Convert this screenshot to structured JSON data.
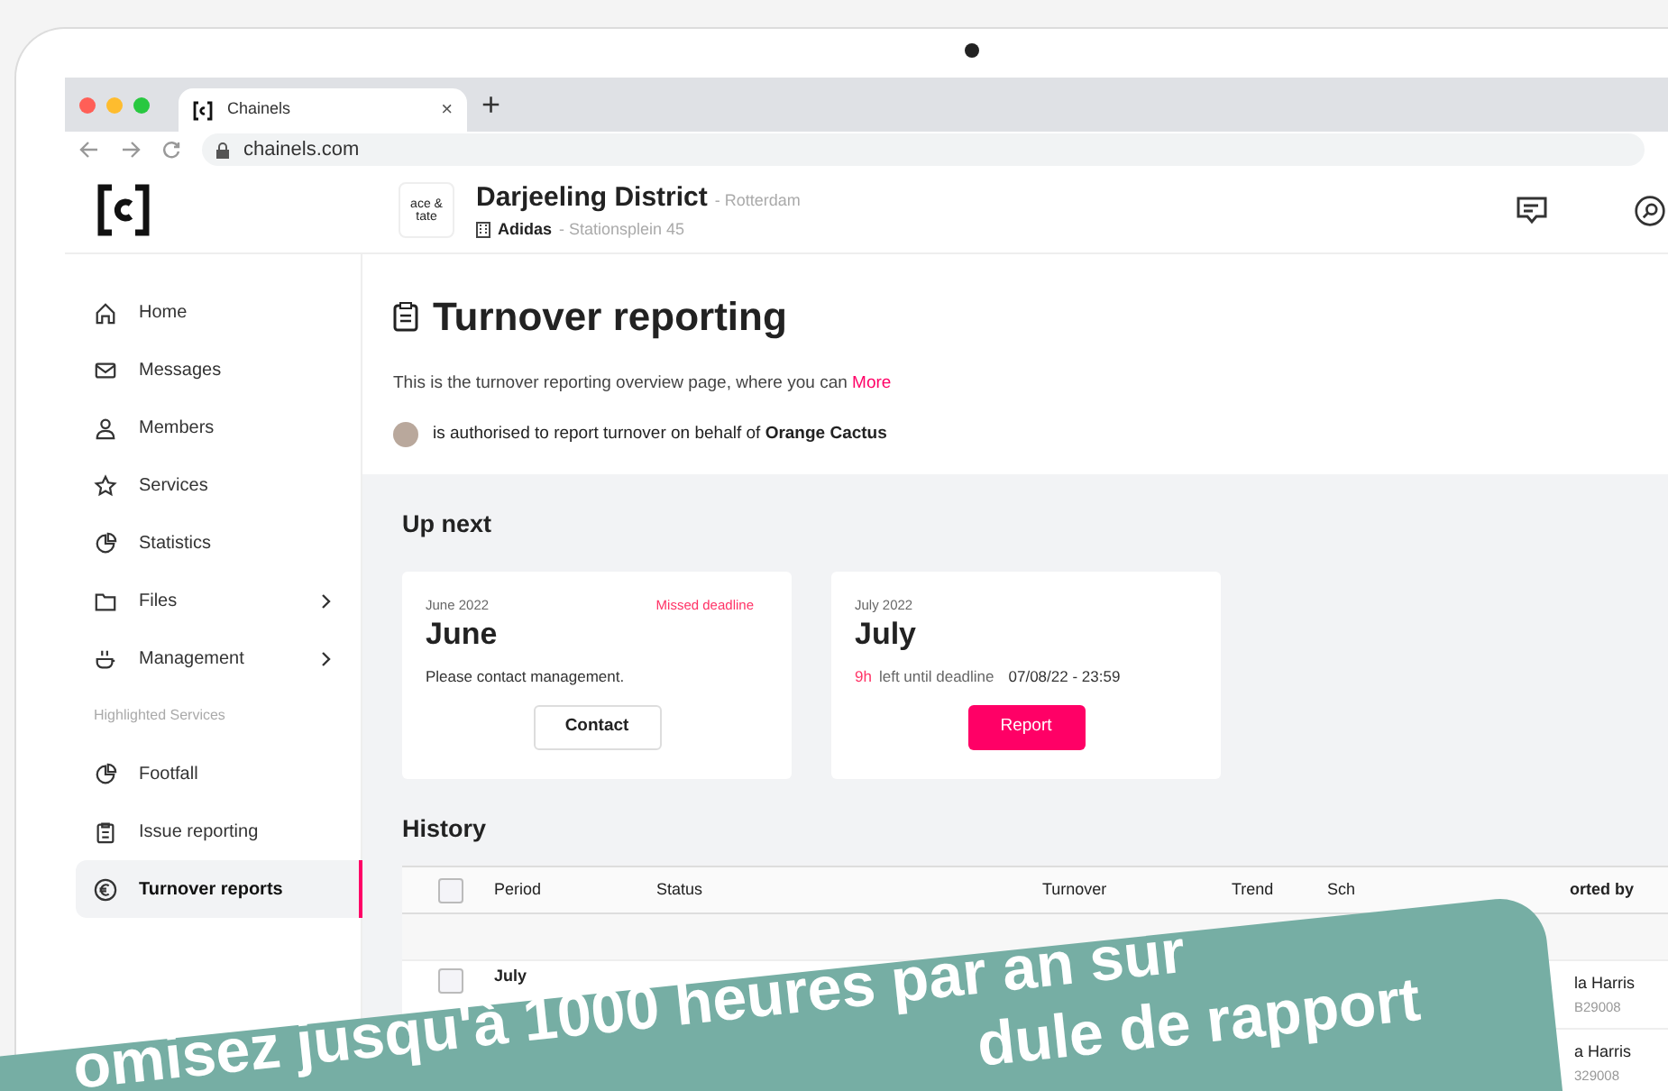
{
  "browser": {
    "tabs": [
      {
        "title": "Chainels",
        "close": "×",
        "selected": true
      }
    ],
    "new_tab": "+",
    "url": "chainels.com"
  },
  "header": {
    "org_logo": "ace & tate",
    "location": "Darjeeling District",
    "city": "- Rotterdam",
    "brand": "Adidas",
    "address": "- Stationsplein 45"
  },
  "sidebar": {
    "items": [
      {
        "label": "Home",
        "selected": false,
        "submenu": false
      },
      {
        "label": "Messages",
        "selected": false,
        "submenu": false
      },
      {
        "label": "Members",
        "selected": false,
        "submenu": false
      },
      {
        "label": "Services",
        "selected": false,
        "submenu": false
      },
      {
        "label": "Statistics",
        "selected": false,
        "submenu": false
      },
      {
        "label": "Files",
        "selected": false,
        "submenu": true
      },
      {
        "label": "Management",
        "selected": false,
        "submenu": true
      },
      {
        "kind": "section",
        "label": "Highlighted Services"
      },
      {
        "label": "Footfall",
        "selected": false,
        "submenu": false
      },
      {
        "label": "Issue reporting",
        "selected": false,
        "submenu": false
      },
      {
        "label": "Turnover reports",
        "selected": true,
        "submenu": false
      }
    ]
  },
  "page": {
    "title": "Turnover reporting",
    "description": "This is the turnover reporting overview page, where you can",
    "more_link": "More",
    "authorisation": "is authorised to report turnover on behalf of **Orange Cactus**"
  },
  "up_next": {
    "heading": "Up next",
    "cards": [
      {
        "kind": "missed",
        "period": "June 2022",
        "month": "June",
        "status": "Missed deadline",
        "message": "Please contact management.",
        "button": "Contact"
      },
      {
        "kind": "open",
        "period": "July 2022",
        "month": "July",
        "hours": "9h",
        "message": "left until deadline",
        "deadline": "07/08/22 - 23:59",
        "button": "Report"
      }
    ]
  },
  "history": {
    "heading": "History",
    "all_checked": false,
    "columns": [
      "Period",
      "Status",
      "Turnover",
      "Trend",
      "Sch",
      "orted by"
    ],
    "rows": [
      {
        "checked": false,
        "period": "July",
        "reporter": "la Harris",
        "reporter_id": "B29008"
      },
      {
        "period": "",
        "reporter": "a Harris",
        "reporter_id": "329008"
      }
    ]
  },
  "banner": {
    "lines": [
      "omisez jusqu'à 1000 heures par an sur",
      "dule de rapport"
    ]
  }
}
